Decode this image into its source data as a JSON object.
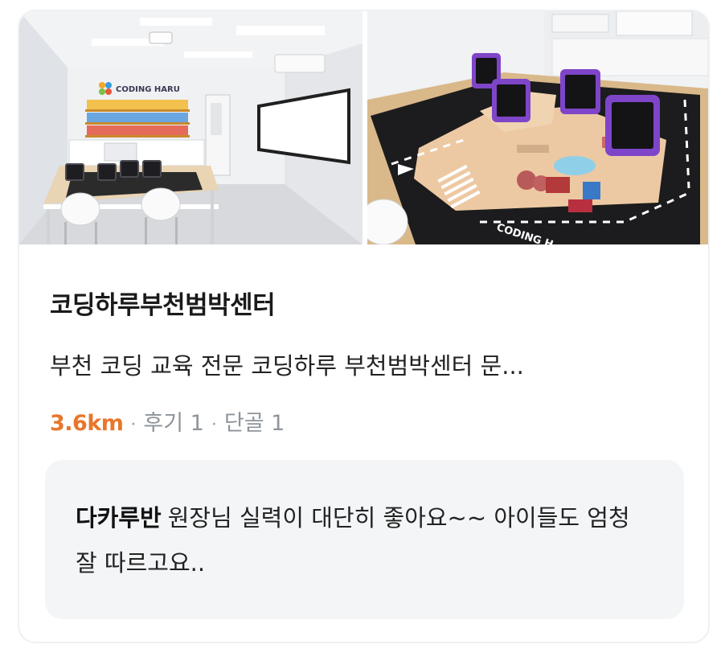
{
  "place": {
    "title": "코딩하루부천범박센터",
    "description": "부천 코딩 교육 전문 코딩하루 부천범박센터 문...",
    "distance": "3.6km",
    "meta_separator": "·",
    "reviews_text": "후기 1",
    "regulars_text": "단골 1"
  },
  "photos": {
    "first": {
      "wall_sign": "CODING HARU"
    },
    "second": {
      "board_text": "CODING H"
    }
  },
  "review": {
    "reviewer": "다카루반",
    "text": "원장님 실력이 대단히 좋아요~~ 아이들도 엄청 잘 따르고요.."
  },
  "colors": {
    "distance": "#e8762b",
    "meta": "#8e949a",
    "review_background": "#f4f5f7",
    "card_border": "#eef0f2"
  }
}
